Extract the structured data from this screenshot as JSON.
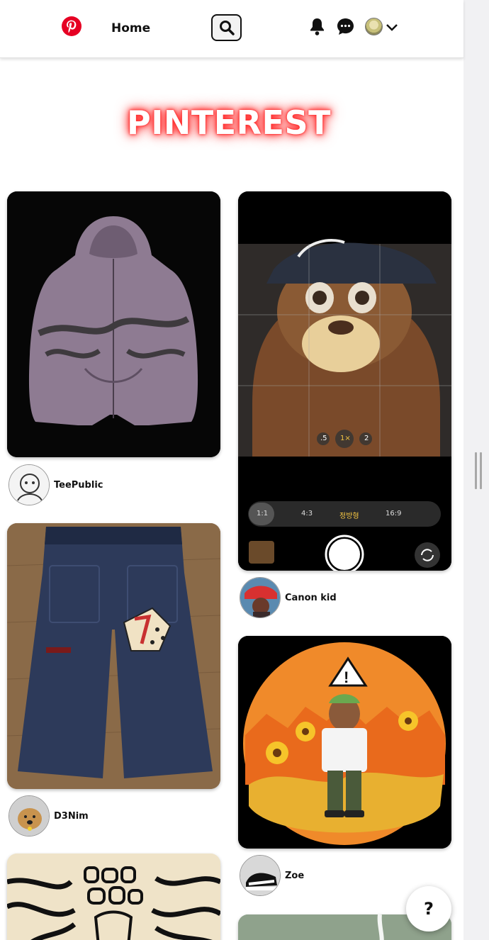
{
  "nav": {
    "home_label": "Home",
    "icons": [
      "pinterest-logo-icon",
      "search-icon",
      "bell-icon",
      "message-icon",
      "chevron-down-icon"
    ]
  },
  "hero": {
    "title": "PINTEREST"
  },
  "pins": [
    {
      "author": "TeePublic",
      "image": "purple zip hoodie"
    },
    {
      "author": "Canon kid",
      "image": "monkey plush camera screenshot"
    },
    {
      "author": "D3Nim",
      "image": "baggy denim jeans"
    },
    {
      "author": "Zoe",
      "image": "circular illustration"
    }
  ],
  "camera_ui": {
    "zoom_options": [
      ".5",
      "1×",
      "2"
    ],
    "aspect_options": [
      "1:1",
      "4:3",
      "정방형",
      "16:9"
    ]
  },
  "help": {
    "label": "?"
  },
  "colors": {
    "brand_red": "#e60023",
    "glow": "#ff2a2a"
  }
}
